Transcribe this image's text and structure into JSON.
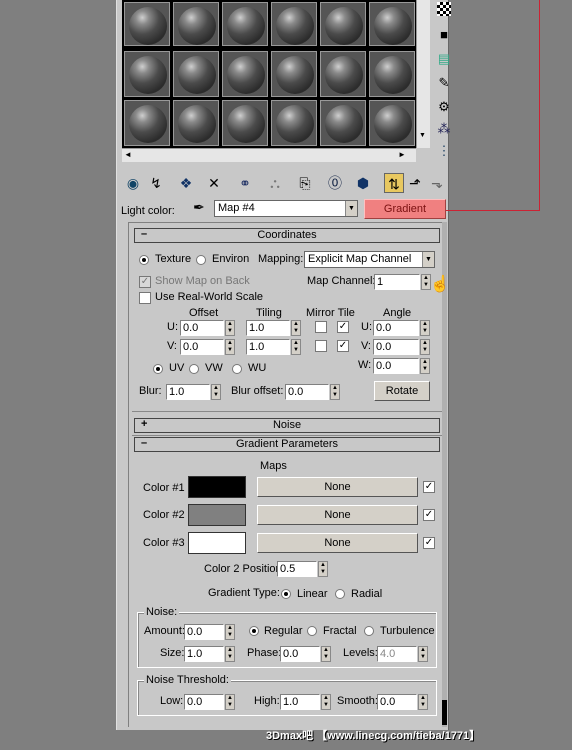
{
  "top_toolbar": {
    "light_color_label": "Light color:",
    "map_name": "Map #4",
    "map_type_button": "Gradient"
  },
  "coordinates": {
    "header": "Coordinates",
    "texture_label": "Texture",
    "environ_label": "Environ",
    "mapping_label": "Mapping:",
    "mapping_value": "Explicit Map Channel",
    "show_map_label": "Show Map on Back",
    "map_channel_label": "Map Channel:",
    "map_channel_value": "1",
    "real_world_label": "Use Real-World Scale",
    "offset_label": "Offset",
    "tiling_label": "Tiling",
    "mirror_tile_label": "Mirror Tile",
    "angle_label": "Angle",
    "u_label": "U:",
    "v_label": "V:",
    "w_label": "W:",
    "offset_u": "0.0",
    "offset_v": "0.0",
    "tiling_u": "1.0",
    "tiling_v": "1.0",
    "angle_u": "0.0",
    "angle_v": "0.0",
    "angle_w": "0.0",
    "uv_label": "UV",
    "vw_label": "VW",
    "wu_label": "WU",
    "blur_label": "Blur:",
    "blur_value": "1.0",
    "blur_offset_label": "Blur offset:",
    "blur_offset_value": "0.0",
    "rotate_button": "Rotate"
  },
  "noise_rollout": {
    "header": "Noise",
    "sign": "+"
  },
  "gradient_params": {
    "header": "Gradient Parameters",
    "maps_label": "Maps",
    "colors": [
      {
        "label": "Color #1",
        "swatch": "#000000",
        "map": "None"
      },
      {
        "label": "Color #2",
        "swatch": "#808080",
        "map": "None"
      },
      {
        "label": "Color #3",
        "swatch": "#ffffff",
        "map": "None"
      }
    ],
    "color2_position_label": "Color 2 Position:",
    "color2_position_value": "0.5",
    "gradient_type_label": "Gradient Type:",
    "linear_label": "Linear",
    "radial_label": "Radial",
    "noise_group_label": "Noise:",
    "amount_label": "Amount:",
    "amount_value": "0.0",
    "regular_label": "Regular",
    "fractal_label": "Fractal",
    "turbulence_label": "Turbulence",
    "size_label": "Size:",
    "size_value": "1.0",
    "phase_label": "Phase:",
    "phase_value": "0.0",
    "levels_label": "Levels:",
    "levels_value": "4.0",
    "threshold_group_label": "Noise Threshold:",
    "low_label": "Low:",
    "low_value": "0.0",
    "high_label": "High:",
    "high_value": "1.0",
    "smooth_label": "Smooth:",
    "smooth_value": "0.0"
  },
  "watermark": "3Dmax吧 【www.linecg.com/tieba/1771】",
  "colors": {
    "highlight": "#ff7070",
    "callout_line": "#cc2233"
  }
}
